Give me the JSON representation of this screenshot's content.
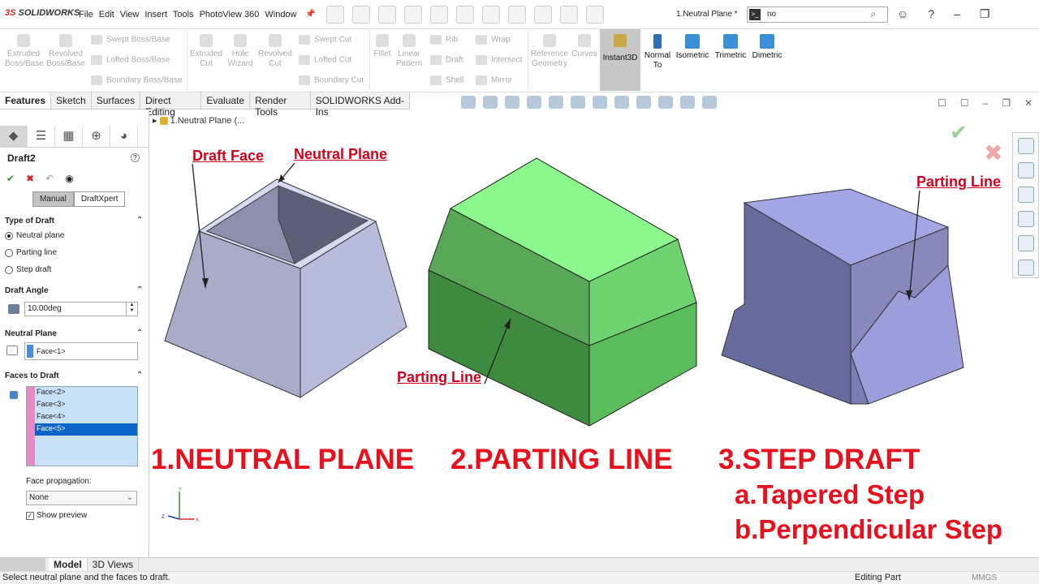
{
  "app": {
    "logo": "SOLIDWORKS",
    "logo_mark": "3S"
  },
  "menu": [
    "File",
    "Edit",
    "View",
    "Insert",
    "Tools",
    "PhotoView 360",
    "Window"
  ],
  "document_title": "1.Neutral Plane *",
  "search": {
    "value": "no"
  },
  "ribbon": {
    "boss": {
      "extruded": "Extruded Boss/Base",
      "revolved": "Revolved Boss/Base",
      "swept": "Swept Boss/Base",
      "lofted": "Lofted Boss/Base",
      "boundary": "Boundary Boss/Base"
    },
    "cut": {
      "extruded": "Extruded Cut",
      "hole": "Hole Wizard",
      "revolved": "Revolved Cut",
      "swept": "Swept Cut",
      "lofted": "Lofted Cut",
      "boundary": "Boundary Cut"
    },
    "features": {
      "fillet": "Fillet",
      "pattern": "Linear Pattern",
      "rib": "Rib",
      "draft": "Draft",
      "shell": "Shell",
      "wrap": "Wrap",
      "intersect": "Intersect",
      "mirror": "Mirror"
    },
    "ref": {
      "geometry": "Reference Geometry",
      "curves": "Curves"
    },
    "instant3d": "Instant3D",
    "views": {
      "normal": "Normal To",
      "iso": "Isometric",
      "tri": "Trimetric",
      "di": "Dimetric"
    }
  },
  "tabs": [
    "Features",
    "Sketch",
    "Surfaces",
    "Direct Editing",
    "Evaluate",
    "Render Tools",
    "SOLIDWORKS Add-Ins"
  ],
  "breadcrumb": "1.Neutral Plane  (...",
  "property_manager": {
    "title": "Draft2",
    "help": "?",
    "modes": [
      "Manual",
      "DraftXpert"
    ],
    "type_of_draft": {
      "label": "Type of Draft",
      "options": [
        "Neutral plane",
        "Parting line",
        "Step draft"
      ],
      "selected": "Neutral plane"
    },
    "draft_angle": {
      "label": "Draft Angle",
      "value": "10.00deg"
    },
    "neutral_plane": {
      "label": "Neutral Plane",
      "value": "Face<1>"
    },
    "faces_to_draft": {
      "label": "Faces to Draft",
      "items": [
        "Face<2>",
        "Face<3>",
        "Face<4>",
        "Face<5>"
      ],
      "selected": "Face<5>"
    },
    "face_propagation": {
      "label": "Face propagation:",
      "value": "None"
    },
    "show_preview": "Show preview"
  },
  "annotations": {
    "draft_face": "Draft Face",
    "neutral_plane": "Neutral Plane",
    "parting_line_1": "Parting Line",
    "parting_line_2": "Parting Line"
  },
  "headings": {
    "h1": "1.NEUTRAL PLANE",
    "h2": "2.PARTING LINE",
    "h3": "3.STEP DRAFT",
    "h3a": "a.Tapered Step",
    "h3b": "b.Perpendicular Step"
  },
  "bottom_tabs": [
    "Model",
    "3D Views"
  ],
  "status": {
    "left": "Select neutral plane and the faces to draft.",
    "middle": "Editing Part",
    "right": "MMGS"
  },
  "colors": {
    "accent": "#e8101c",
    "green_block_top": "#8cf78c",
    "step_block": "#9c9cdc",
    "draft_body": "#a8acc8"
  }
}
